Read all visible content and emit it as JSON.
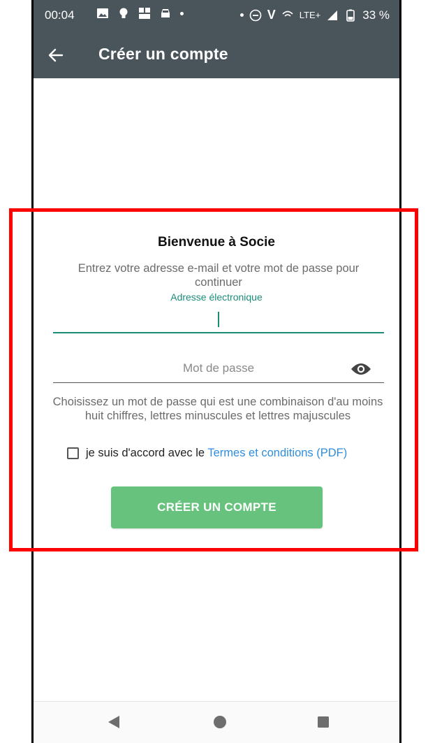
{
  "status_bar": {
    "time": "00:04",
    "network": "LTE+",
    "battery": "33 %",
    "vo_label": "V"
  },
  "app_bar": {
    "title": "Créer un compte"
  },
  "form": {
    "welcome": "Bienvenue à Socie",
    "subtitle": "Entrez votre adresse e-mail et votre mot de passe pour continuer",
    "email_label": "Adresse électronique",
    "email_value": "",
    "password_placeholder": "Mot de passe",
    "password_hint": "Choisissez un mot de passe qui est une combinaison d'au moins huit chiffres, lettres minuscules et lettres majuscules",
    "terms_prefix": "je suis d'accord avec le ",
    "terms_link": "Termes et conditions (PDF)",
    "terms_checked": false,
    "create_button": "CRÉER UN COMPTE"
  },
  "colors": {
    "app_bar": "#4a545b",
    "accent": "#1a8c78",
    "button": "#67c27d",
    "link": "#2f8ee0",
    "highlight": "#ff0000"
  },
  "icons": {
    "back": "arrow-left-icon",
    "eye": "eye-icon",
    "nav_back": "triangle-back-icon",
    "nav_home": "circle-home-icon",
    "nav_recents": "square-recents-icon"
  }
}
